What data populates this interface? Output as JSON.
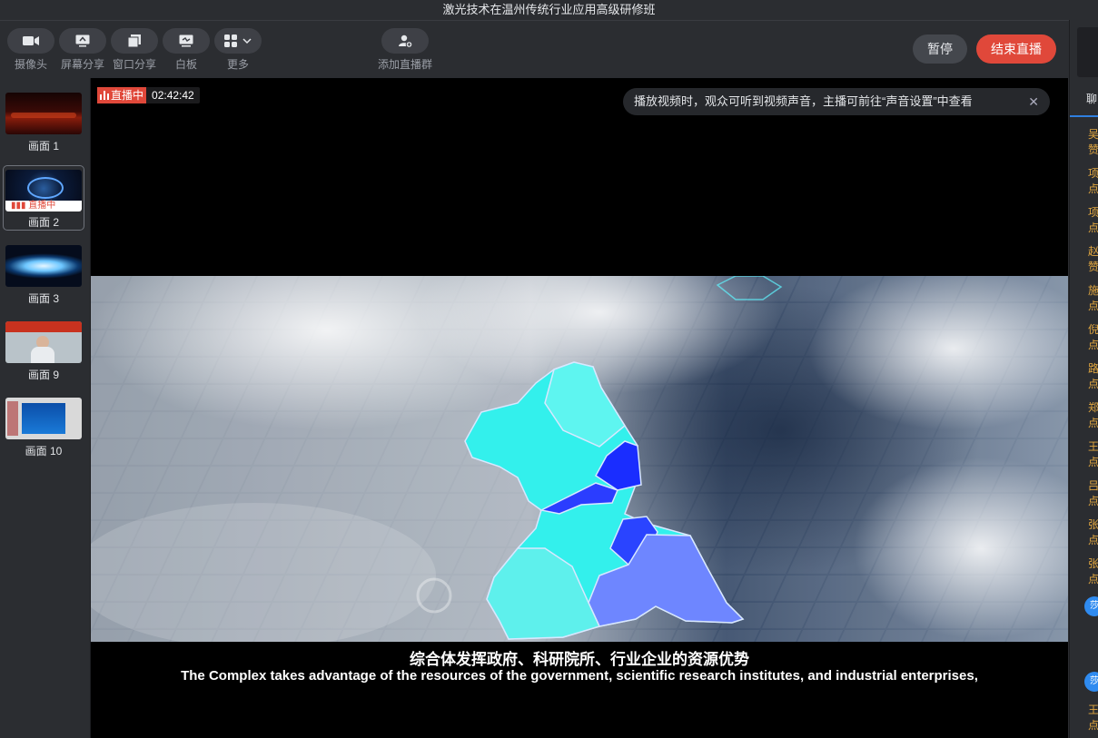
{
  "window": {
    "title": "激光技术在温州传统行业应用高级研修班"
  },
  "toolbar": {
    "camera": "摄像头",
    "screen_share": "屏幕分享",
    "window_share": "窗口分享",
    "whiteboard": "白板",
    "more": "更多",
    "add_group": "添加直播群",
    "pause": "暂停",
    "end_live": "结束直播"
  },
  "scenes": [
    {
      "label": "画面 1"
    },
    {
      "label": "画面 2",
      "badge": "直播中"
    },
    {
      "label": "画面 3"
    },
    {
      "label": "画面 9"
    },
    {
      "label": "画面 10"
    }
  ],
  "video": {
    "live_label": "直播中",
    "timer": "02:42:42",
    "notice": "播放视频时，观众可听到视频声音，主播可前往“声音设置”中查看",
    "subtitle_cn": "综合体发挥政府、科研院所、行业企业的资源优势",
    "subtitle_en": "The Complex takes advantage of the resources of the government, scientific research institutes, and industrial enterprises,"
  },
  "chat": {
    "tab": "聊",
    "entries": [
      {
        "name": "吴",
        "text": "赞"
      },
      {
        "name": "项",
        "text": "点"
      },
      {
        "name": "项",
        "text": "点"
      },
      {
        "name": "赵",
        "text": "赞"
      },
      {
        "name": "施",
        "text": "点"
      },
      {
        "name": "倪",
        "text": "点"
      },
      {
        "name": "路",
        "text": "点"
      },
      {
        "name": "郑",
        "text": "点"
      },
      {
        "name": "王",
        "text": "点"
      },
      {
        "name": "吕",
        "text": "点"
      },
      {
        "name": "张",
        "text": "点"
      },
      {
        "name": "张",
        "text": "点"
      }
    ],
    "avatar1": "莎",
    "avatar2": "莎",
    "last": {
      "name": "王",
      "text": "点"
    }
  },
  "colors": {
    "accent": "#2f7fe0",
    "danger": "#e0483a",
    "chat_name": "#e0a640"
  }
}
